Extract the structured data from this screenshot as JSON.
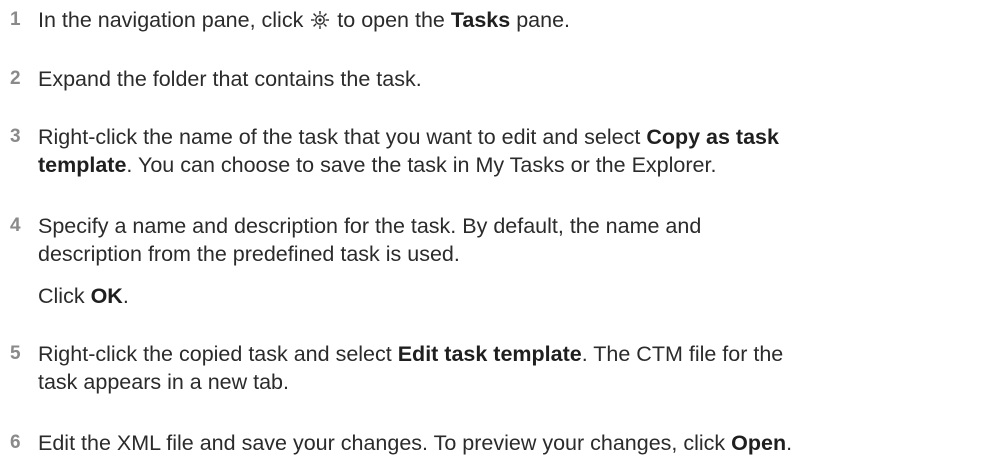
{
  "steps": [
    {
      "number": "1",
      "parts": {
        "a": "In the navigation pane, click ",
        "icon": "tasks-gear-icon",
        "b": " to open the ",
        "c": "Tasks",
        "d": " pane."
      }
    },
    {
      "number": "2",
      "parts": {
        "a": "Expand the folder that contains the task."
      }
    },
    {
      "number": "3",
      "parts": {
        "a": "Right-click the name of the task that you want to edit and select ",
        "b": "Copy as task",
        "c": "template",
        "d": ". You can choose to save the task in My Tasks or the Explorer."
      }
    },
    {
      "number": "4",
      "parts": {
        "a": "Specify a name and description for the task. By default, the name and",
        "b": "description from the predefined task is used.",
        "c": "Click ",
        "d": "OK",
        "e": "."
      }
    },
    {
      "number": "5",
      "parts": {
        "a": "Right-click the copied task and select ",
        "b": "Edit task template",
        "c": ". The CTM file for the",
        "d": "task appears in a new tab."
      }
    },
    {
      "number": "6",
      "parts": {
        "a": "Edit the XML file and save your changes. To preview your changes, click ",
        "b": "Open",
        "c": "."
      }
    }
  ]
}
